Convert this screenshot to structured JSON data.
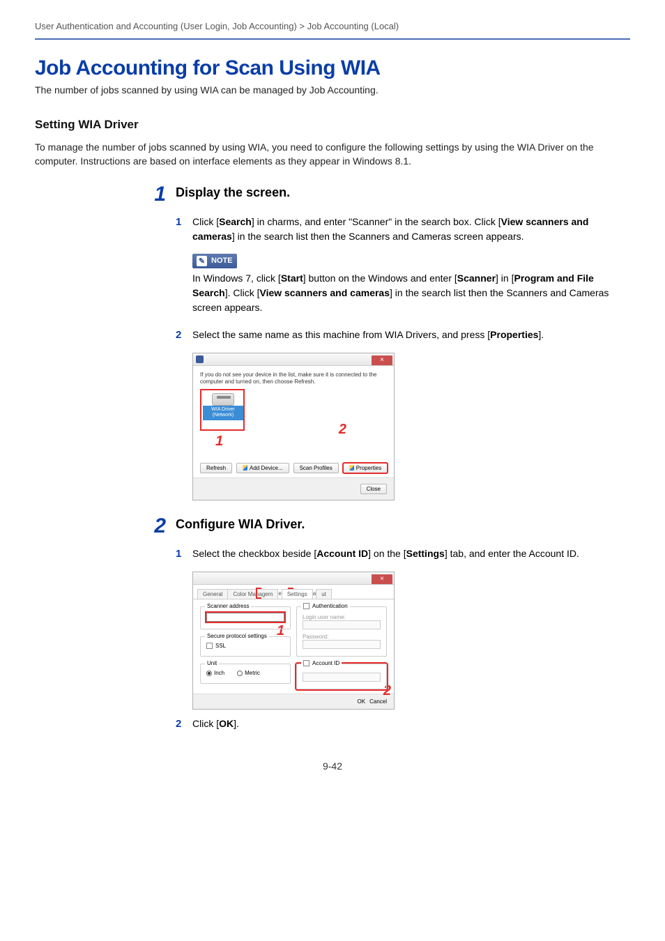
{
  "breadcrumb": "User Authentication and Accounting (User Login, Job Accounting) > Job Accounting (Local)",
  "h1": "Job Accounting for Scan Using WIA",
  "intro": "The number of jobs scanned by using WIA can be managed by Job Accounting.",
  "h2": "Setting WIA Driver",
  "sec_desc": "To manage the number of jobs scanned by using WIA, you need to configure the following settings by using the WIA Driver on the computer. Instructions are based on interface elements as they appear in Windows 8.1.",
  "steps": {
    "s1": {
      "num": "1",
      "title": "Display the screen.",
      "sub1": {
        "n": "1",
        "prefix": "Click [",
        "b1": "Search",
        "mid1": "] in charms, and enter \"Scanner\" in the search box. Click [",
        "b2": "View scanners and cameras",
        "mid2": "] in the search list then the Scanners and Cameras screen appears."
      },
      "note": {
        "label": "NOTE",
        "prefix": "In Windows 7, click [",
        "b1": "Start",
        "m1": "] button on the Windows and enter [",
        "b2": "Scanner",
        "m2": "] in [",
        "b3": "Program and File Search",
        "m3": "]. Click [",
        "b4": "View scanners and cameras",
        "m4": "] in the search list then the Scanners and Cameras screen appears."
      },
      "sub2": {
        "n": "2",
        "prefix": "Select the same name as this machine from WIA Drivers, and press [",
        "b1": "Properties",
        "suffix": "]."
      }
    },
    "s2": {
      "num": "2",
      "title": "Configure WIA Driver.",
      "sub1": {
        "n": "1",
        "prefix": "Select the checkbox beside [",
        "b1": "Account ID",
        "mid": "] on the [",
        "b2": "Settings",
        "suffix": "] tab, and enter the Account ID."
      },
      "sub2": {
        "n": "2",
        "prefix": "Click [",
        "b1": "OK",
        "suffix": "]."
      }
    }
  },
  "dlg1": {
    "hint": "If you do not see your device in the list, make sure it is connected to the computer and turned on, then choose Refresh.",
    "device": "WIA Driver (Network)",
    "refresh": "Refresh",
    "add": "Add Device...",
    "scan": "Scan Profiles",
    "props": "Properties",
    "close": "Close",
    "c1": "1",
    "c2": "2"
  },
  "dlg2": {
    "tabs": {
      "general": "General",
      "color": "Color Managem",
      "g1": "e",
      "settings": "Settings",
      "g2": "a",
      "out": "ut"
    },
    "scanner_addr": "Scanner address",
    "secure": "Secure protocol settings",
    "ssl": "SSL",
    "unit": "Unit",
    "inch": "Inch",
    "metric": "Metric",
    "auth": "Authentication",
    "login": "Login user name:",
    "password": "Password:",
    "acct": "Account ID",
    "ok": "OK",
    "cancel": "Cancel",
    "c1": "1",
    "c2": "2"
  },
  "page_num": "9-42"
}
